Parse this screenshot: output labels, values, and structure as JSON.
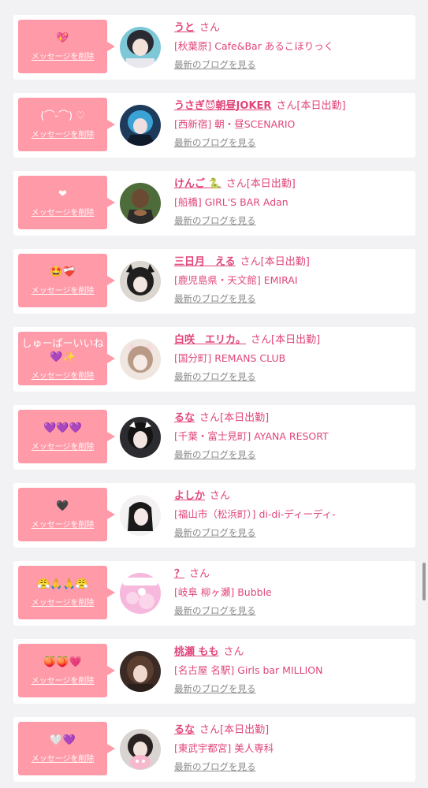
{
  "colors": {
    "bubble": "#ff9aa8",
    "accent": "#e0457b",
    "muted": "#8a8a8a",
    "page_bg": "#f2f2f4",
    "card_bg": "#ffffff"
  },
  "delete_label": "メッセージを削除",
  "blog_label": "最新のブログを見る",
  "san_label": "さん",
  "messages": [
    {
      "bubble": "💖",
      "name": "うと",
      "workday": "",
      "shop": "[秋葉原] Cafe&Bar あるこほりっく",
      "avatar_icon": "girl-photo-avatar-icon"
    },
    {
      "bubble": "(⌒-⌒) ♡",
      "name": "うさぎ😈朝昼JOKER",
      "workday": "[本日出勤]",
      "shop": "[西新宿] 朝・昼SCENARIO",
      "avatar_icon": "girl-photo-avatar-icon"
    },
    {
      "bubble": "❤",
      "name": "けんご 🐍",
      "workday": "[本日出勤]",
      "shop": "[船橋] GIRL'S BAR Adan",
      "avatar_icon": "man-photo-avatar-icon"
    },
    {
      "bubble": "🤩❤️‍🩹",
      "name": "三日月　える",
      "workday": "[本日出勤]",
      "shop": "[鹿児島県・天文館] EMIRAI",
      "avatar_icon": "girl-photo-avatar-icon"
    },
    {
      "bubble": "しゅーぱーいいね\n💜✨",
      "name": "白咲　エリカ。",
      "workday": "[本日出勤]",
      "shop": "[国分町] REMANS CLUB",
      "avatar_icon": "girl-photo-avatar-icon"
    },
    {
      "bubble": "💜💜💜",
      "name": "るな",
      "workday": "[本日出勤]",
      "shop": "[千葉・富士見町] AYANA RESORT",
      "avatar_icon": "girl-photo-avatar-icon"
    },
    {
      "bubble": "🖤",
      "name": "よしか",
      "workday": "",
      "shop": "[福山市（松浜町）] di-di-ディーディ-",
      "avatar_icon": "girl-photo-avatar-icon"
    },
    {
      "bubble": "😤🙏🙏😤",
      "name": "？",
      "workday": "",
      "shop": "[岐阜 柳ヶ瀬] Bubble",
      "avatar_icon": "bubble-logo-avatar-icon"
    },
    {
      "bubble": "🍑🍑💗",
      "name": "桃瀬 もも",
      "workday": "",
      "shop": "[名古屋 名駅] Girls bar MILLION",
      "avatar_icon": "girl-photo-avatar-icon"
    },
    {
      "bubble": "🤍💜",
      "name": "るな",
      "workday": "[本日出勤]",
      "shop": "[東武宇都宮] 美人専科",
      "avatar_icon": "girl-photo-avatar-icon"
    }
  ]
}
